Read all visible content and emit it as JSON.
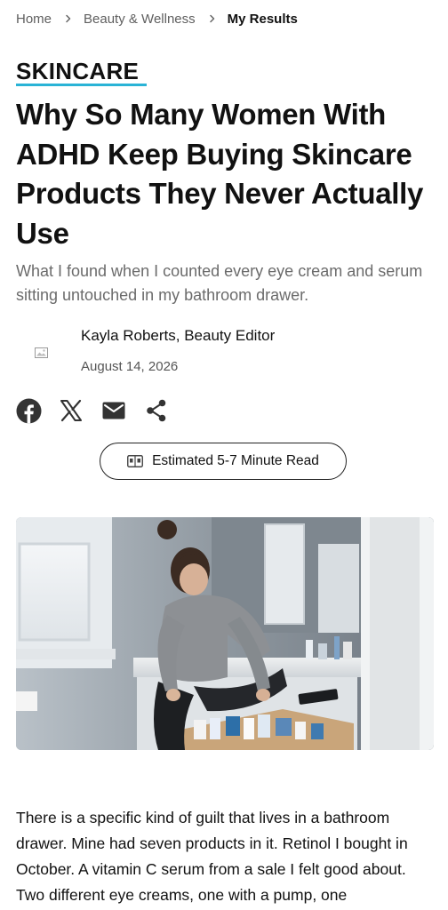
{
  "breadcrumb": {
    "items": [
      "Home",
      "Beauty & Wellness"
    ],
    "current": "My Results"
  },
  "article": {
    "category": "SKINCARE",
    "headline": "Why So Many Women With ADHD Keep Buying Skincare Products They Never Actually Use",
    "dek": "What I found when I counted every eye cream and serum sitting untouched in my bathroom drawer.",
    "author": "Kayla Roberts, Beauty Editor",
    "date": "August 14, 2026",
    "read_time": "Estimated 5-7 Minute Read",
    "body": "There is a specific kind of guilt that lives in a bathroom drawer. Mine had seven products in it. Retinol I bought in October. A vitamin C serum from a sale I felt good about. Two different eye creams, one with a pump, one"
  },
  "share": {
    "icons": [
      "facebook-icon",
      "x-icon",
      "email-icon",
      "share-icon"
    ]
  },
  "colors": {
    "accent_underline": "#2ab3d6",
    "text": "#111111",
    "muted": "#6b6b6b"
  }
}
